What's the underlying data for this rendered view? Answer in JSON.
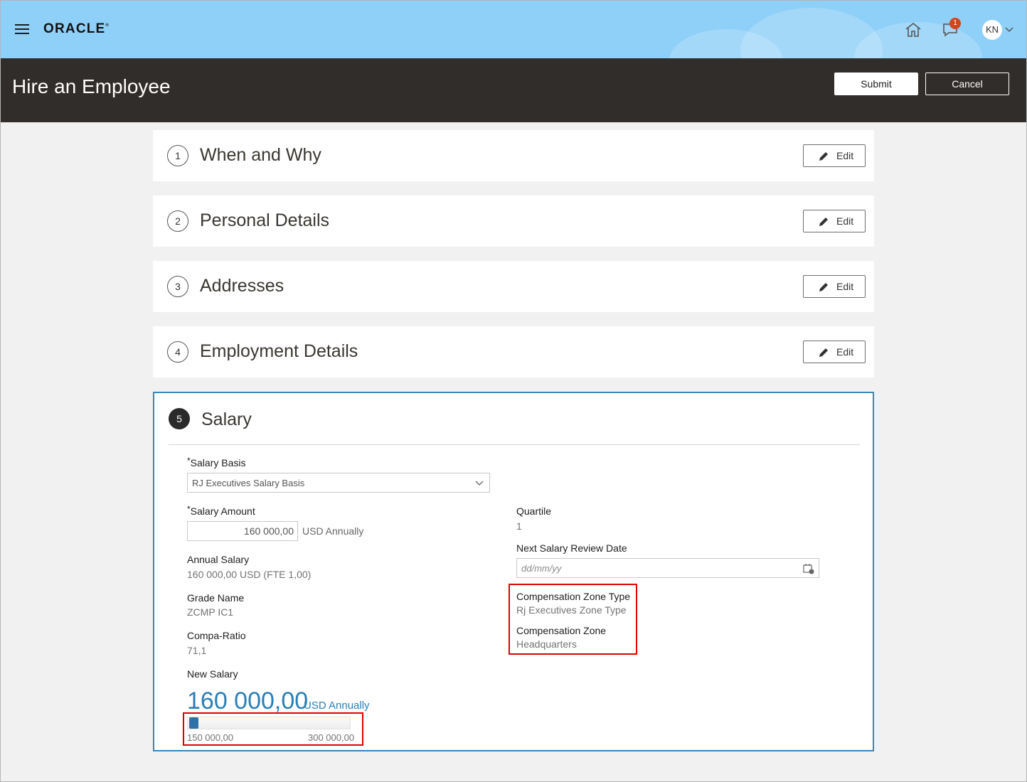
{
  "app": {
    "logo": "ORACLE",
    "notification_count": "1",
    "user_initials": "KN"
  },
  "header": {
    "title": "Hire an Employee",
    "submit_label": "Submit",
    "cancel_label": "Cancel"
  },
  "sections": [
    {
      "number": "1",
      "title": "When and Why",
      "edit_label": "Edit"
    },
    {
      "number": "2",
      "title": "Personal Details",
      "edit_label": "Edit"
    },
    {
      "number": "3",
      "title": "Addresses",
      "edit_label": "Edit"
    },
    {
      "number": "4",
      "title": "Employment Details",
      "edit_label": "Edit"
    }
  ],
  "salary": {
    "number": "5",
    "title": "Salary",
    "salary_basis_label": "Salary Basis",
    "salary_basis_value": "RJ Executives Salary Basis",
    "salary_amount_label": "Salary Amount",
    "salary_amount_value": "160 000,00",
    "salary_amount_unit": "USD Annually",
    "annual_salary_label": "Annual Salary",
    "annual_salary_value": "160 000,00 USD (FTE 1,00)",
    "grade_name_label": "Grade Name",
    "grade_name_value": "ZCMP IC1",
    "compa_ratio_label": "Compa-Ratio",
    "compa_ratio_value": "71,1",
    "new_salary_label": "New Salary",
    "new_salary_value": "160 000,00",
    "new_salary_unit": "USD Annually",
    "range_min": "150 000,00",
    "range_max": "300 000,00",
    "range_position": 0.0,
    "quartile_label": "Quartile",
    "quartile_value": "1",
    "next_review_label": "Next Salary Review Date",
    "next_review_placeholder": "dd/mm/yy",
    "zone_type_label": "Compensation Zone Type",
    "zone_type_value": "Rj Executives Zone Type",
    "zone_label": "Compensation Zone",
    "zone_value": "Headquarters"
  },
  "colors": {
    "topbar": "#8fd0f8",
    "header": "#312d2a",
    "accent": "#2a7fb8",
    "highlight": "#e00000",
    "badge": "#d6441b"
  }
}
